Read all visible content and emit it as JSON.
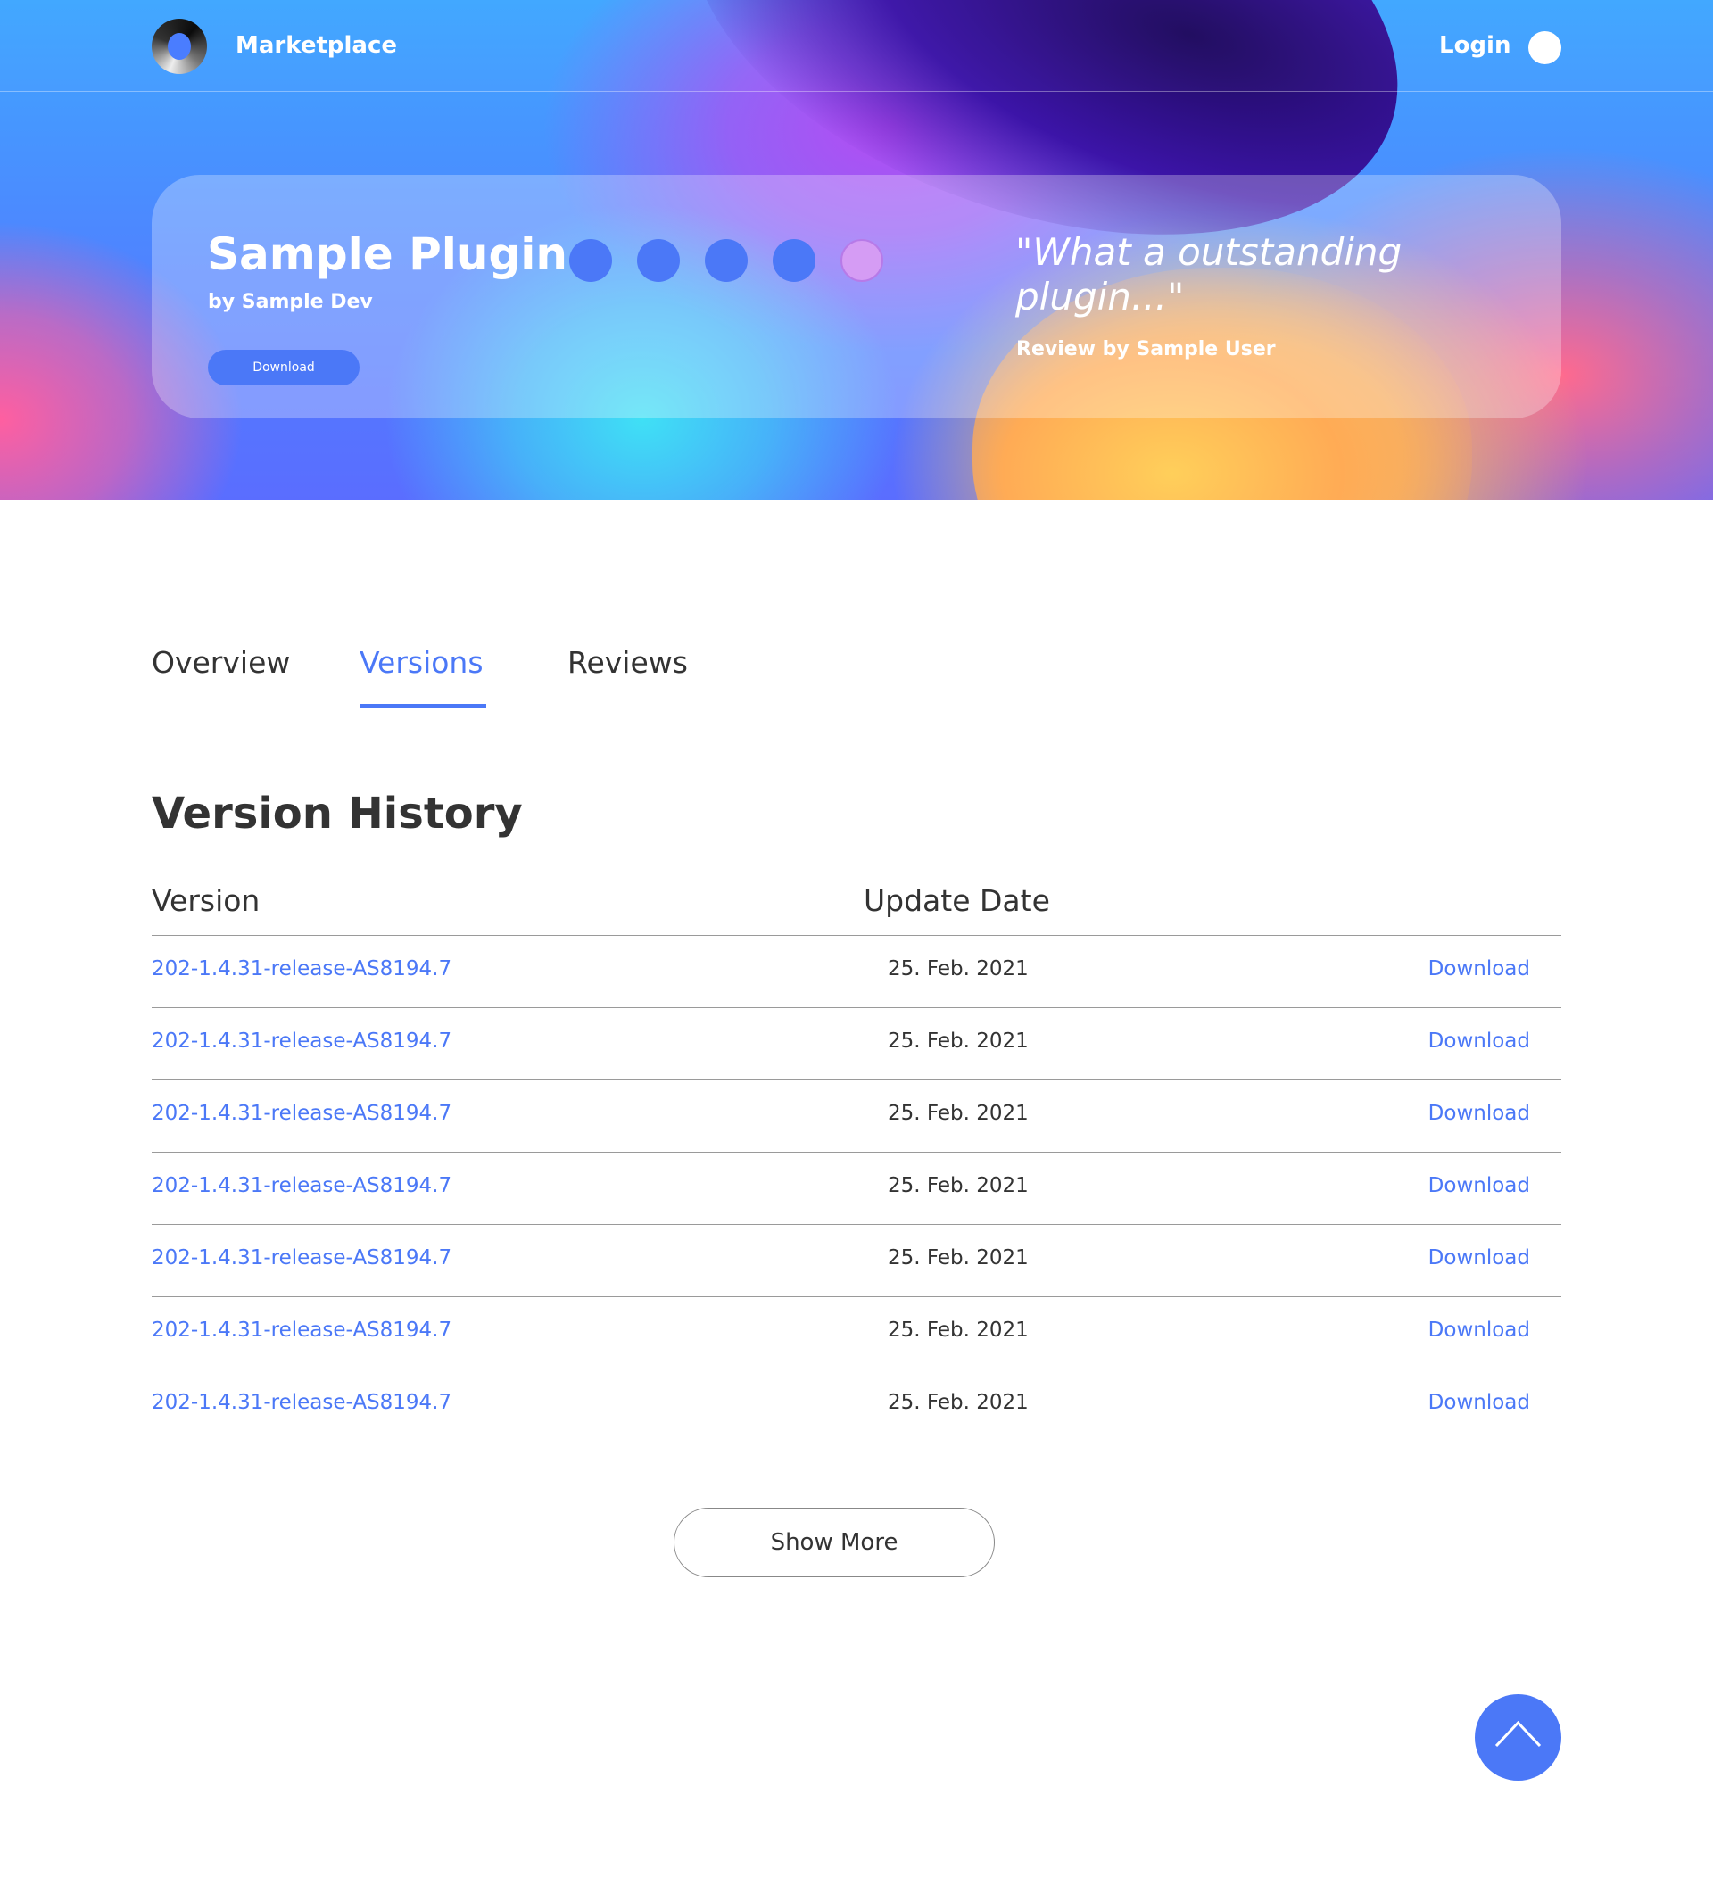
{
  "header": {
    "brand_name": "Marketplace",
    "login_label": "Login"
  },
  "hero": {
    "plugin_title": "Sample Plugin",
    "plugin_dev": "by Sample Dev",
    "download_label": "Download",
    "rating": {
      "value": 4,
      "max": 5
    },
    "quote": "\"What a outstanding plugin...\"",
    "quote_author": "Review by Sample User"
  },
  "tabs": [
    {
      "label": "Overview",
      "active": false
    },
    {
      "label": "Versions",
      "active": true
    },
    {
      "label": "Reviews",
      "active": false
    }
  ],
  "version_history": {
    "title": "Version History",
    "columns": {
      "version": "Version",
      "date": "Update Date"
    },
    "rows": [
      {
        "version": "202-1.4.31-release-AS8194.7",
        "date": "25. Feb. 2021",
        "action": "Download"
      },
      {
        "version": "202-1.4.31-release-AS8194.7",
        "date": "25. Feb. 2021",
        "action": "Download"
      },
      {
        "version": "202-1.4.31-release-AS8194.7",
        "date": "25. Feb. 2021",
        "action": "Download"
      },
      {
        "version": "202-1.4.31-release-AS8194.7",
        "date": "25. Feb. 2021",
        "action": "Download"
      },
      {
        "version": "202-1.4.31-release-AS8194.7",
        "date": "25. Feb. 2021",
        "action": "Download"
      },
      {
        "version": "202-1.4.31-release-AS8194.7",
        "date": "25. Feb. 2021",
        "action": "Download"
      },
      {
        "version": "202-1.4.31-release-AS8194.7",
        "date": "25. Feb. 2021",
        "action": "Download"
      }
    ],
    "show_more_label": "Show More"
  },
  "colors": {
    "accent": "#4b78f7",
    "text": "#333333",
    "star_empty": "#d59cf4"
  },
  "icons": {
    "brand": "logo-icon",
    "user": "user-avatar-icon",
    "back_to_top": "chevron-up-icon"
  }
}
